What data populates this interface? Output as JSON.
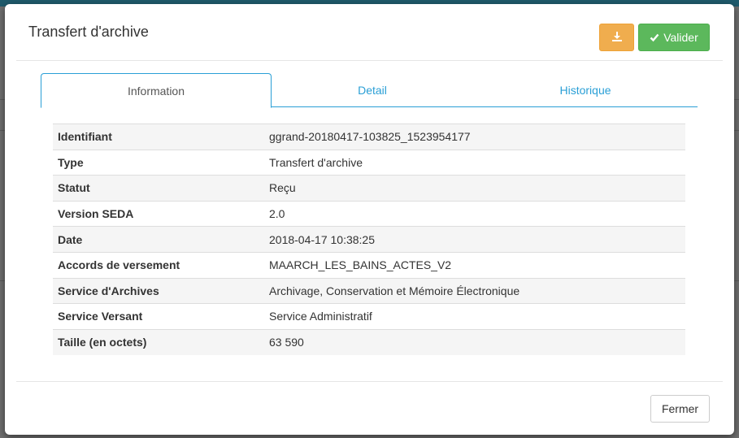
{
  "modal": {
    "title": "Transfert d'archive",
    "download_icon": "download-icon",
    "validate_icon": "check-icon",
    "validate_label": "Valider",
    "close_label": "Fermer"
  },
  "tabs": [
    {
      "label": "Information",
      "active": true
    },
    {
      "label": "Detail",
      "active": false
    },
    {
      "label": "Historique",
      "active": false
    }
  ],
  "info": {
    "rows": [
      {
        "key": "Identifiant",
        "value": "ggrand-20180417-103825_1523954177"
      },
      {
        "key": "Type",
        "value": "Transfert d'archive"
      },
      {
        "key": "Statut",
        "value": "Reçu"
      },
      {
        "key": "Version SEDA",
        "value": "2.0"
      },
      {
        "key": "Date",
        "value": "2018-04-17 10:38:25"
      },
      {
        "key": "Accords de versement",
        "value": "MAARCH_LES_BAINS_ACTES_V2"
      },
      {
        "key": "Service d'Archives",
        "value": "Archivage, Conservation et Mémoire Électronique"
      },
      {
        "key": "Service Versant",
        "value": "Service Administratif"
      },
      {
        "key": "Taille (en octets)",
        "value": "63 590"
      }
    ]
  },
  "colors": {
    "accent": "#2a9fd6",
    "warning": "#f0ad4e",
    "success": "#5cb85c"
  }
}
